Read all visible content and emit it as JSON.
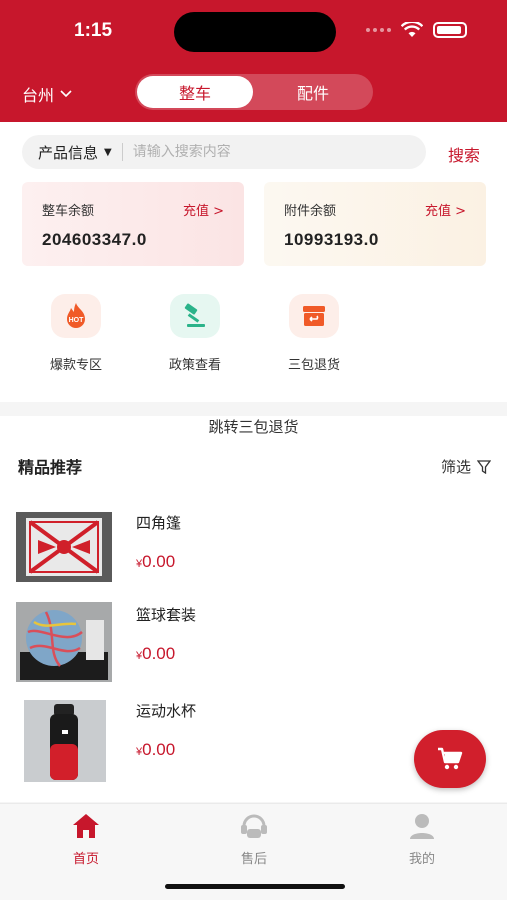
{
  "status_bar": {
    "time": "1:15"
  },
  "header": {
    "city": "台州",
    "tabs": [
      {
        "label": "整车",
        "active": true
      },
      {
        "label": "配件",
        "active": false
      }
    ]
  },
  "search": {
    "category": "产品信息",
    "placeholder": "请输入搜索内容",
    "button_label": "搜索"
  },
  "balances": [
    {
      "label": "整车余额",
      "recharge_label": "充值 >",
      "value": "204603347.0"
    },
    {
      "label": "附件余额",
      "recharge_label": "充值 >",
      "value": "10993193.0"
    }
  ],
  "quick_links": [
    {
      "label": "爆款专区",
      "icon": "hot-icon",
      "icon_text": "HOT"
    },
    {
      "label": "政策查看",
      "icon": "gavel-icon"
    },
    {
      "label": "三包退货",
      "icon": "return-box-icon"
    }
  ],
  "jump_link": "跳转三包退货",
  "section": {
    "title": "精品推荐",
    "filter_label": "筛选"
  },
  "products": [
    {
      "name": "四角篷",
      "currency": "¥",
      "price": "0.00",
      "image": "canopy-photo"
    },
    {
      "name": "篮球套装",
      "currency": "¥",
      "price": "0.00",
      "image": "basketball-set-photo"
    },
    {
      "name": "运动水杯",
      "currency": "¥",
      "price": "0.00",
      "image": "water-bottle-photo"
    }
  ],
  "tabbar": [
    {
      "label": "首页",
      "active": true,
      "icon": "home-icon"
    },
    {
      "label": "售后",
      "active": false,
      "icon": "after-sales-icon"
    },
    {
      "label": "我的",
      "active": false,
      "icon": "user-icon"
    }
  ],
  "colors": {
    "brand_red": "#c7172c",
    "hot_orange": "#f05a28",
    "policy_green": "#2bb38a"
  }
}
